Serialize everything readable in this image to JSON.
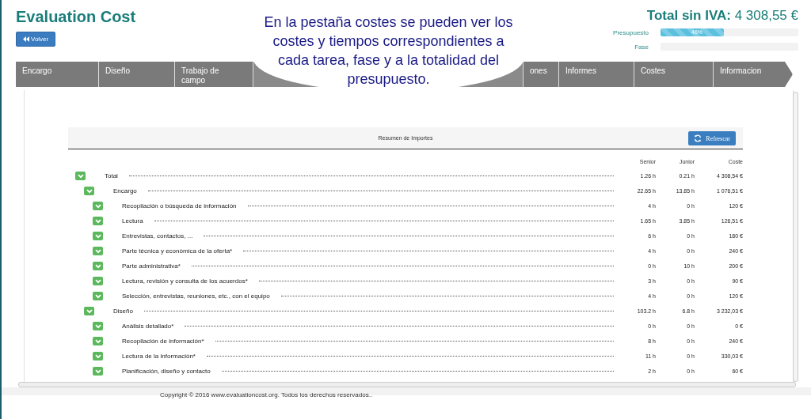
{
  "app": {
    "title": "Evaluation Cost",
    "back_button": "Volver"
  },
  "totals": {
    "label": "Total sin IVA:",
    "value": "4 308,55 €",
    "meters": [
      {
        "label": "Presupuesto",
        "level": 0.46,
        "reading": "46%"
      },
      {
        "label": "Fase",
        "level": 0
      }
    ]
  },
  "tabs": [
    {
      "label": "Encargo"
    },
    {
      "label": "Diseño"
    },
    {
      "label": "Trabajo de campo"
    },
    {
      "kind": "covered"
    },
    {
      "label": "ones"
    },
    {
      "label": "Informes"
    },
    {
      "label": "Costes"
    },
    {
      "label": "Informacion"
    }
  ],
  "callout": "En la pestaña costes se pueden ver los costes y tiempos correspondientes a cada tarea, fase y a la totalidad del presupuesto.",
  "summary": {
    "title": "Resumen de Importes",
    "refresh_button": "Refrescar",
    "columns": [
      "Senior",
      "Junior",
      "Coste"
    ],
    "rows": [
      {
        "name": "Total",
        "expanded": true,
        "senior": "1.26 h",
        "junior": "0.21 h",
        "cost": "4 308,54 €",
        "children": [
          {
            "name": "Encargo",
            "expanded": true,
            "senior": "22.65 h",
            "junior": "13.85 h",
            "cost": "1 076,51 €",
            "children": [
              {
                "name": "Recopilación o búsqueda de información",
                "expanded": true,
                "senior": "4 h",
                "junior": "0 h",
                "cost": "120 €"
              },
              {
                "name": "Lectura",
                "expanded": true,
                "senior": "1.65 h",
                "junior": "3.85 h",
                "cost": "126,51 €"
              },
              {
                "name": "Entrevistas, contactos, ...",
                "expanded": true,
                "senior": "6 h",
                "junior": "0 h",
                "cost": "180 €"
              },
              {
                "name": "Parte técnica y económica de la oferta*",
                "expanded": true,
                "senior": "4 h",
                "junior": "0 h",
                "cost": "240 €"
              },
              {
                "name": "Parte administrativa*",
                "expanded": true,
                "senior": "0 h",
                "junior": "10 h",
                "cost": "200 €"
              },
              {
                "name": "Lectura, revisión y consulta de los acuerdos*",
                "expanded": true,
                "senior": "3 h",
                "junior": "0 h",
                "cost": "90 €"
              },
              {
                "name": "Selección, entrevistas, reuniones, etc., con el equipo",
                "expanded": true,
                "senior": "4 h",
                "junior": "0 h",
                "cost": "120 €"
              }
            ]
          },
          {
            "name": "Diseño",
            "expanded": true,
            "senior": "103.2 h",
            "junior": "6.8 h",
            "cost": "3 232,03 €",
            "children": [
              {
                "name": "Análisis detallado*",
                "expanded": true,
                "senior": "0 h",
                "junior": "0 h",
                "cost": "0 €"
              },
              {
                "name": "Recopilación de información*",
                "expanded": true,
                "senior": "8 h",
                "junior": "0 h",
                "cost": "240 €"
              },
              {
                "name": "Lectura de la información*",
                "expanded": true,
                "senior": "11 h",
                "junior": "0 h",
                "cost": "330,03 €"
              },
              {
                "name": "Planificación, diseño y contacto",
                "expanded": true,
                "senior": "2 h",
                "junior": "0 h",
                "cost": "60 €"
              }
            ]
          }
        ]
      }
    ]
  },
  "footer": "Copyright © 2016 www.evaluationcost.org. Todos los derechos reservados.."
}
